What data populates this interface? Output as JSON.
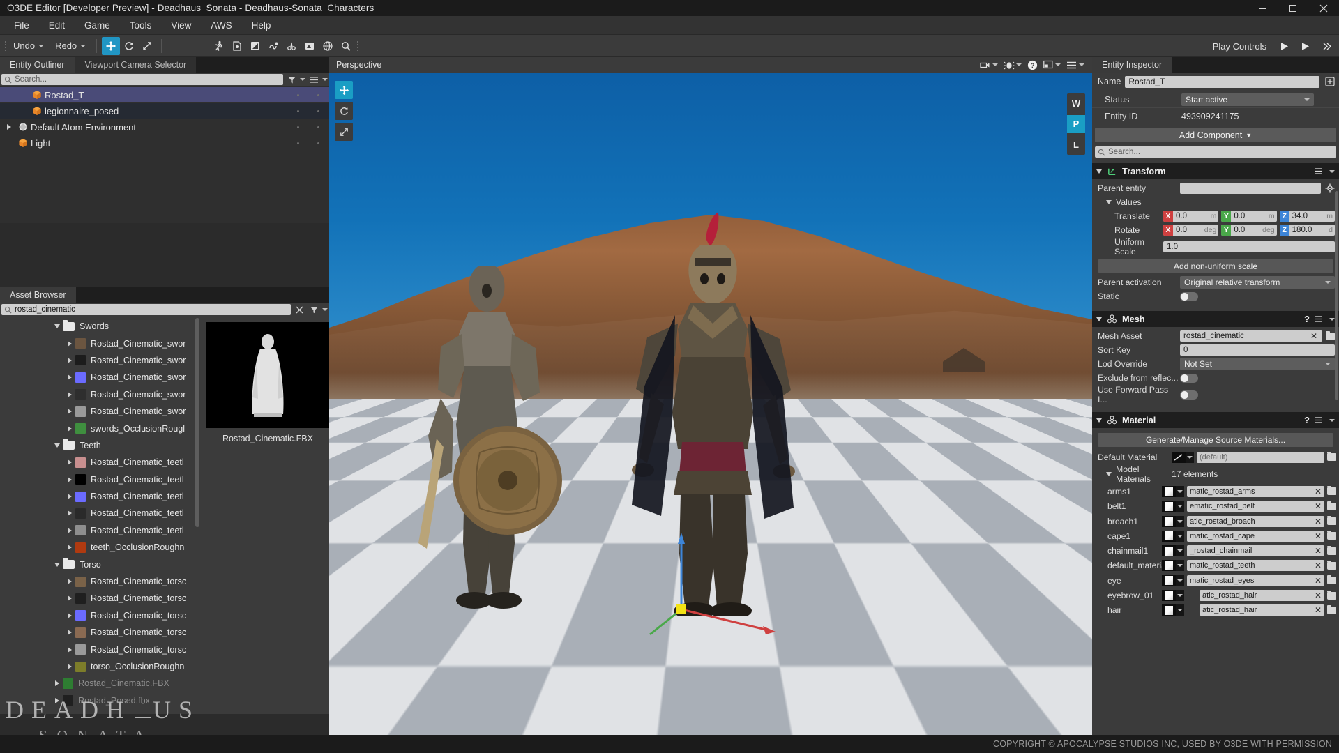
{
  "window": {
    "title": "O3DE Editor [Developer Preview] - Deadhaus_Sonata - Deadhaus-Sonata_Characters",
    "minimize": "minimize-icon",
    "maximize": "maximize-icon",
    "close": "close-icon"
  },
  "menu": {
    "items": [
      {
        "label": "File",
        "accel": "F"
      },
      {
        "label": "Edit",
        "accel": "E"
      },
      {
        "label": "Game",
        "accel": "G"
      },
      {
        "label": "Tools",
        "accel": "T"
      },
      {
        "label": "View",
        "accel": "V"
      },
      {
        "label": "AWS",
        "accel": "A"
      },
      {
        "label": "Help",
        "accel": "H"
      }
    ]
  },
  "toolbar": {
    "undo_label": "Undo",
    "redo_label": "Redo",
    "transform_tools": [
      "move-tool-icon",
      "rotate-tool-icon",
      "scale-tool-icon"
    ],
    "mode_tools": [
      "play-game-icon",
      "simulate-icon",
      "environment-icon",
      "physics-icon",
      "audio-icon",
      "terrain-icon",
      "globe-icon",
      "search-tool-icon"
    ],
    "play_controls_label": "Play Controls",
    "play_icon": "play-icon",
    "play_alt_icon": "play-maximized-icon",
    "more_icon": "overflow-icon"
  },
  "outliner": {
    "tabs": [
      {
        "label": "Entity Outliner",
        "active": true
      },
      {
        "label": "Viewport Camera Selector",
        "active": false
      }
    ],
    "search_placeholder": "Search...",
    "filter_icon": "filter-icon",
    "options_icon": "list-options-icon",
    "entities": [
      {
        "name": "Rostad_T",
        "icon": "entity-cube-icon",
        "selected": true,
        "expandable": false,
        "indent": 1
      },
      {
        "name": "legionnaire_posed",
        "icon": "entity-cube-icon",
        "selected": false,
        "expandable": false,
        "indent": 1
      },
      {
        "name": "Default Atom Environment",
        "icon": "environment-icon",
        "selected": false,
        "expandable": true,
        "indent": 0
      },
      {
        "name": "Light",
        "icon": "entity-cube-icon",
        "selected": false,
        "expandable": false,
        "indent": 1
      }
    ]
  },
  "asset_browser": {
    "tab_label": "Asset Browser",
    "search_value": "rostad_cinematic",
    "search_placeholder": "Search...",
    "clear_icon": "clear-x-icon",
    "filter_icon": "filter-icon",
    "preview": {
      "filename": "Rostad_Cinematic.FBX",
      "thumbnail": "fbx-character-thumbnail"
    },
    "tree": [
      {
        "label": "Swords",
        "type": "folder",
        "depth": 1,
        "expanded": true
      },
      {
        "label": "Rostad_Cinematic_swor",
        "type": "asset",
        "depth": 2,
        "swatch": "#6b5540"
      },
      {
        "label": "Rostad_Cinematic_swor",
        "type": "asset",
        "depth": 2,
        "swatch": "#1c1c1c"
      },
      {
        "label": "Rostad_Cinematic_swor",
        "type": "asset",
        "depth": 2,
        "swatch": "#6b6bff"
      },
      {
        "label": "Rostad_Cinematic_swor",
        "type": "asset",
        "depth": 2,
        "swatch": "#2e2e2e"
      },
      {
        "label": "Rostad_Cinematic_swor",
        "type": "asset",
        "depth": 2,
        "swatch": "#9a9a9a"
      },
      {
        "label": "swords_OcclusionRougl",
        "type": "asset",
        "depth": 2,
        "swatch": "#3f8f3f"
      },
      {
        "label": "Teeth",
        "type": "folder",
        "depth": 1,
        "expanded": true
      },
      {
        "label": "Rostad_Cinematic_teetl",
        "type": "asset",
        "depth": 2,
        "swatch": "#c88f8f"
      },
      {
        "label": "Rostad_Cinematic_teetl",
        "type": "asset",
        "depth": 2,
        "swatch": "#000000"
      },
      {
        "label": "Rostad_Cinematic_teetl",
        "type": "asset",
        "depth": 2,
        "swatch": "#6b6bff"
      },
      {
        "label": "Rostad_Cinematic_teetl",
        "type": "asset",
        "depth": 2,
        "swatch": "#2a2a2a"
      },
      {
        "label": "Rostad_Cinematic_teetl",
        "type": "asset",
        "depth": 2,
        "swatch": "#8e8e8e"
      },
      {
        "label": "teeth_OcclusionRoughn",
        "type": "asset",
        "depth": 2,
        "swatch": "#b03a10"
      },
      {
        "label": "Torso",
        "type": "folder",
        "depth": 1,
        "expanded": true
      },
      {
        "label": "Rostad_Cinematic_torsс",
        "type": "asset",
        "depth": 2,
        "swatch": "#7a6248"
      },
      {
        "label": "Rostad_Cinematic_torsс",
        "type": "asset",
        "depth": 2,
        "swatch": "#1f1f1f"
      },
      {
        "label": "Rostad_Cinematic_torsс",
        "type": "asset",
        "depth": 2,
        "swatch": "#6b6bff"
      },
      {
        "label": "Rostad_Cinematic_torsс",
        "type": "asset",
        "depth": 2,
        "swatch": "#8a6a52"
      },
      {
        "label": "Rostad_Cinematic_torsс",
        "type": "asset",
        "depth": 2,
        "swatch": "#9a9a9a"
      },
      {
        "label": "torso_OcclusionRoughn",
        "type": "asset",
        "depth": 2,
        "swatch": "#7d7d2a"
      },
      {
        "label": "Rostad_Cinematic.FBX",
        "type": "file",
        "depth": 1,
        "swatch": "#2e7d32",
        "dim": true
      },
      {
        "label": "Rostad_Posed.fbx",
        "type": "file",
        "depth": 1,
        "swatch": "#202020",
        "dim": true
      }
    ]
  },
  "viewport": {
    "label": "Perspective",
    "tools": [
      "camera-icon",
      "debug-icon",
      "help-icon",
      "layout-icon",
      "viewport-menu-icon"
    ],
    "left_tools": [
      "transform-mode-icon",
      "rotate-mode-icon",
      "scale-mode-icon"
    ],
    "space_selector": [
      "W",
      "P",
      "L"
    ],
    "space_selected": "P",
    "axis_labels": {
      "x": "X",
      "y": "Y",
      "z": "Z"
    }
  },
  "inspector": {
    "tab_label": "Entity Inspector",
    "name_label": "Name",
    "name_value": "Rostad_T",
    "name_icon": "add-to-favorites-icon",
    "status_label": "Status",
    "status_value": "Start active",
    "entity_id_label": "Entity ID",
    "entity_id_value": "493909241175",
    "add_component_label": "Add Component",
    "search_placeholder": "Search...",
    "transform": {
      "title": "Transform",
      "icon": "transform-icon",
      "parent_entity_label": "Parent entity",
      "parent_entity_value": "",
      "picker_icon": "entity-picker-icon",
      "values_label": "Values",
      "translate_label": "Translate",
      "translate": {
        "x": "0.0",
        "y": "0.0",
        "z": "34.0",
        "unit": "m"
      },
      "rotate_label": "Rotate",
      "rotate": {
        "x": "0.0",
        "y": "0.0",
        "z": "180.0",
        "unit": "deg"
      },
      "uniform_scale_label": "Uniform Scale",
      "uniform_scale_value": "1.0",
      "add_non_uniform_label": "Add non-uniform scale",
      "parent_activation_label": "Parent activation",
      "parent_activation_value": "Original relative transform",
      "static_label": "Static",
      "static_on": false
    },
    "mesh": {
      "title": "Mesh",
      "icon": "mesh-icon",
      "help_icon": "help-icon",
      "menu_icon": "component-menu-icon",
      "mesh_asset_label": "Mesh Asset",
      "mesh_asset_value": "rostad_cinematic",
      "sort_key_label": "Sort Key",
      "sort_key_value": "0",
      "lod_override_label": "Lod Override",
      "lod_override_value": "Not Set",
      "exclude_reflection_label": "Exclude from reflec...",
      "exclude_reflection_on": false,
      "forward_pass_label": "Use Forward Pass I...",
      "forward_pass_on": false
    },
    "material": {
      "title": "Material",
      "icon": "material-icon",
      "generate_label": "Generate/Manage Source Materials...",
      "default_material_label": "Default Material",
      "default_material_value": "(default)",
      "model_materials_label": "Model Materials",
      "model_materials_count": "17 elements",
      "rows": [
        {
          "slot": "arms1",
          "value": "matic_rostad_arms",
          "short": false
        },
        {
          "slot": "belt1",
          "value": "ematic_rostad_belt",
          "short": false
        },
        {
          "slot": "broach1",
          "value": "atic_rostad_broach",
          "short": false
        },
        {
          "slot": "cape1",
          "value": "matic_rostad_cape",
          "short": false
        },
        {
          "slot": "chainmail1",
          "value": "_rostad_chainmail",
          "short": false
        },
        {
          "slot": "default_material",
          "value": "matic_rostad_teeth",
          "short": false
        },
        {
          "slot": "eye",
          "value": "matic_rostad_eyes",
          "short": false
        },
        {
          "slot": "eyebrow_01",
          "value": "atic_rostad_hair",
          "short": true
        },
        {
          "slot": "hair",
          "value": "atic_rostad_hair",
          "short": true
        }
      ]
    }
  },
  "watermark": {
    "line1": "DEADH",
    "line1b": "US",
    "line2": "SONATA"
  },
  "status": {
    "copyright": "COPYRIGHT © APOCALYPSE STUDIOS INC, USED BY O3DE WITH PERMISSION"
  },
  "colors": {
    "accent": "#1a9ec4",
    "selection": "#4a4b78",
    "panel_bg": "#3b3b3b",
    "header_bg": "#1e1e1e",
    "axis_x": "#cf4040",
    "axis_y": "#4aa84a",
    "axis_z": "#3d85d8"
  }
}
